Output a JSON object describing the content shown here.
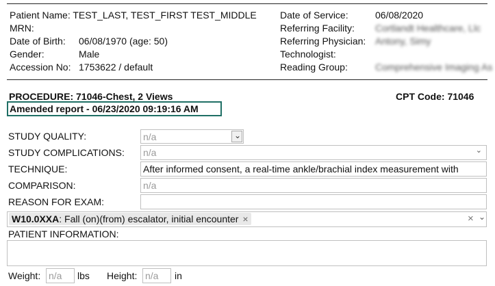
{
  "patient": {
    "name_label": "Patient Name:",
    "name_value": "TEST_LAST, TEST_FIRST TEST_MIDDLE",
    "mrn_label": "MRN:",
    "dob_label": "Date of Birth:",
    "dob_value": "06/08/1970 (age: 50)",
    "gender_label": "Gender:",
    "gender_value": "Male",
    "accession_label": "Accession No:",
    "accession_value": "1753622 / default",
    "dos_label": "Date of Service:",
    "dos_value": "06/08/2020",
    "facility_label": "Referring Facility:",
    "facility_value": "Cortlandt Healthcare, Llc",
    "physician_label": "Referring Physician:",
    "physician_value": "Antony, Simy",
    "technologist_label": "Technologist:",
    "reading_group_label": "Reading Group:",
    "reading_group_value": "Comprehensive Imaging Associates"
  },
  "procedure": {
    "title": "PROCEDURE: 71046-Chest, 2 Views",
    "cpt": "CPT Code: 71046",
    "amended": "Amended report - 06/23/2020 09:19:16 AM"
  },
  "form": {
    "study_quality_label": "STUDY QUALITY:",
    "study_quality_value": "n/a",
    "study_complications_label": "STUDY COMPLICATIONS:",
    "study_complications_value": "n/a",
    "technique_label": "TECHNIQUE:",
    "technique_value": "After informed consent, a real-time ankle/brachial index measurement with",
    "comparison_label": "COMPARISON:",
    "comparison_placeholder": "n/a",
    "reason_label": "REASON FOR EXAM:",
    "diagnosis_code": "W10.0XXA",
    "diagnosis_text": ": Fall (on)(from) escalator, initial encounter",
    "patient_info_label": "PATIENT INFORMATION:",
    "weight_label": "Weight:",
    "weight_placeholder": "n/a",
    "weight_unit": "lbs",
    "height_label": "Height:",
    "height_placeholder": "n/a",
    "height_unit": "in"
  },
  "icons": {
    "chevron": "⌄",
    "clear": "×",
    "tag_remove": "×"
  }
}
